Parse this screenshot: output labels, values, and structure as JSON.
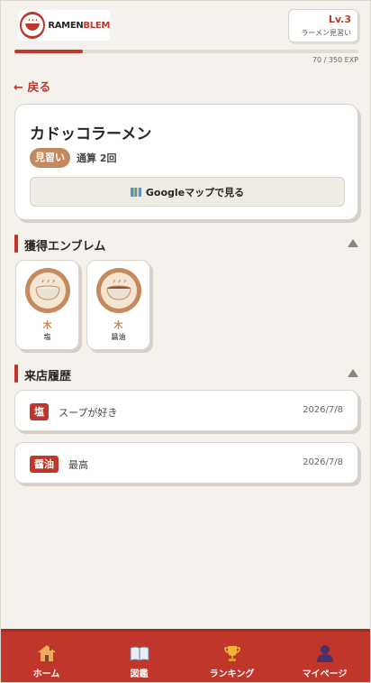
{
  "header": {
    "logo_text_a": "RAMEN",
    "logo_text_b": "BLEM",
    "level": "Lv.3",
    "level_title": "ラーメン見習い",
    "xp_text": "70 / 350 EXP",
    "xp_progress": 0.2
  },
  "back_label": "← 戻る",
  "shop": {
    "name": "カドッコラーメン",
    "rank": "見習い",
    "visit_count": "通算 2回",
    "maps_button": "Googleマップで見る"
  },
  "emblems_section": {
    "title": "獲得エンブレム",
    "items": [
      {
        "rank": "木",
        "label": "塩",
        "icon": "shio-ramen-bowl-icon"
      },
      {
        "rank": "木",
        "label": "醤油",
        "icon": "shoyu-ramen-bowl-icon"
      }
    ]
  },
  "history_section": {
    "title": "来店履歴",
    "items": [
      {
        "tag": "塩",
        "comment": "スープが好き",
        "date": "2026/7/8"
      },
      {
        "tag": "醤油",
        "comment": "最高",
        "date": "2026/7/8"
      }
    ]
  },
  "nav": {
    "items": [
      {
        "label": "ホーム",
        "icon": "home-icon"
      },
      {
        "label": "図鑑",
        "icon": "book-icon"
      },
      {
        "label": "ランキング",
        "icon": "trophy-icon"
      },
      {
        "label": "マイページ",
        "icon": "user-icon"
      }
    ]
  },
  "colors": {
    "accent": "#c1362a",
    "rank": "#c48a5e",
    "background": "#f5f2ed"
  }
}
